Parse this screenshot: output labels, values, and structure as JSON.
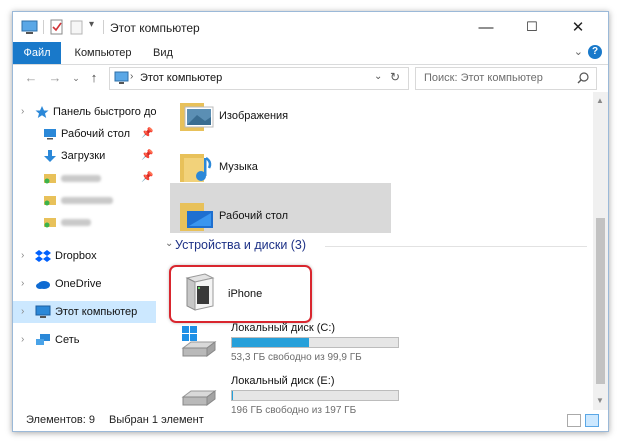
{
  "window": {
    "title": "Этот компьютер",
    "controls": [
      "—",
      "☐",
      "✕"
    ]
  },
  "ribbon": {
    "tabs": [
      "Файл",
      "Компьютер",
      "Вид"
    ],
    "help": "?"
  },
  "address": {
    "path": "Этот компьютер",
    "search_placeholder": "Поиск: Этот компьютер"
  },
  "nav": {
    "quick_access": "Панель быстрого до",
    "items": [
      {
        "label": "Рабочий стол",
        "pinned": true
      },
      {
        "label": "Загрузки",
        "pinned": true
      }
    ],
    "roots": [
      {
        "label": "Dropbox"
      },
      {
        "label": "OneDrive"
      },
      {
        "label": "Этот компьютер",
        "selected": true
      },
      {
        "label": "Сеть"
      }
    ]
  },
  "folders": [
    {
      "label": "Изображения",
      "icon": "pictures-folder-icon"
    },
    {
      "label": "Музыка",
      "icon": "music-folder-icon"
    },
    {
      "label": "Рабочий стол",
      "icon": "desktop-folder-icon",
      "selected": true
    }
  ],
  "devices": {
    "header": "Устройства и диски (3)",
    "iphone": {
      "label": "iPhone"
    },
    "drives": [
      {
        "label": "Локальный диск (C:)",
        "free": "53,3 ГБ свободно из 99,9 ГБ",
        "used_fraction": 0.466
      },
      {
        "label": "Локальный диск (E:)",
        "free": "196 ГБ свободно из 197 ГБ",
        "used_fraction": 0.005
      }
    ]
  },
  "status": {
    "count": "Элементов: 9",
    "selection": "Выбран 1 элемент"
  },
  "colors": {
    "accent": "#1979ca",
    "selection": "#cce8ff",
    "highlight": "#d9262e",
    "bar_fill": "#26a0da"
  }
}
